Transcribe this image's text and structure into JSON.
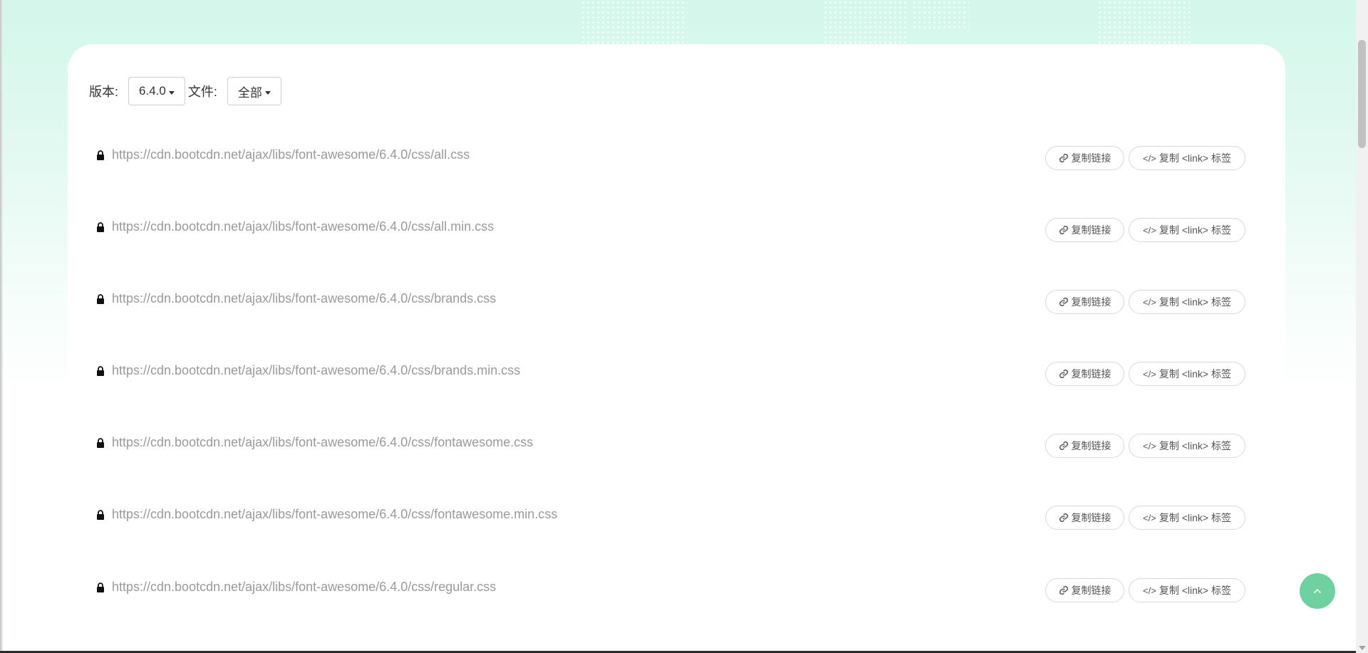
{
  "toolbar": {
    "version_label": "版本:",
    "version_value": "6.4.0",
    "file_label": "文件:",
    "file_value": "全部"
  },
  "buttons": {
    "copy_link": "复制链接",
    "copy_tag": "复制 <link> 标签"
  },
  "files": [
    {
      "url": "https://cdn.bootcdn.net/ajax/libs/font-awesome/6.4.0/css/all.css"
    },
    {
      "url": "https://cdn.bootcdn.net/ajax/libs/font-awesome/6.4.0/css/all.min.css"
    },
    {
      "url": "https://cdn.bootcdn.net/ajax/libs/font-awesome/6.4.0/css/brands.css"
    },
    {
      "url": "https://cdn.bootcdn.net/ajax/libs/font-awesome/6.4.0/css/brands.min.css"
    },
    {
      "url": "https://cdn.bootcdn.net/ajax/libs/font-awesome/6.4.0/css/fontawesome.css"
    },
    {
      "url": "https://cdn.bootcdn.net/ajax/libs/font-awesome/6.4.0/css/fontawesome.min.css"
    },
    {
      "url": "https://cdn.bootcdn.net/ajax/libs/font-awesome/6.4.0/css/regular.css"
    }
  ],
  "colors": {
    "accent": "#6fd0a0",
    "header_bg": "#d3f7ea",
    "url_text": "#9a9a9a"
  }
}
